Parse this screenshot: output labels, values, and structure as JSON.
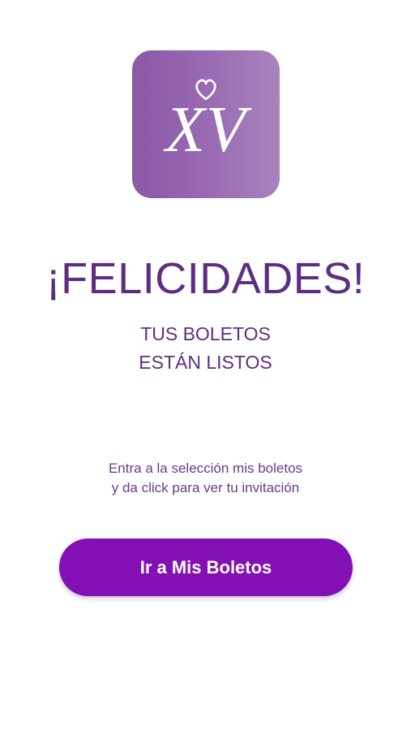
{
  "logo": {
    "letters": "XV",
    "icon": "heart-icon",
    "colors": {
      "tile_start": "#8a58a6",
      "tile_end": "#a884bf",
      "ink": "#ffffff"
    }
  },
  "headline": "¡FELICIDADES!",
  "subtitle": {
    "line1": "TUS BOLETOS",
    "line2": "ESTÁN LISTOS"
  },
  "instruction": {
    "line1": "Entra a la selección mis boletos",
    "line2": "y da click para ver tu invitación"
  },
  "cta": {
    "label": "Ir a Mis Boletos"
  },
  "colors": {
    "text_primary": "#5e2d82",
    "button_bg": "#8210b5",
    "button_text": "#ffffff",
    "background": "#ffffff"
  }
}
